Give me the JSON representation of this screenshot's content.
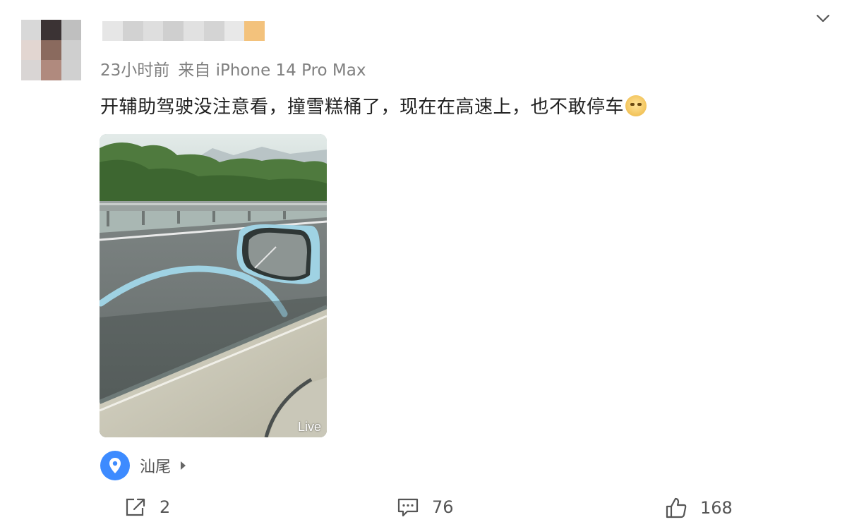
{
  "post": {
    "meta": {
      "time": "23小时前",
      "source": "来自 iPhone 14 Pro Max"
    },
    "text": "开辅助驾驶没注意看，撞雪糕桶了，现在在高速上，也不敢停车",
    "emoji_icon": "laughing-emoji-icon",
    "media": {
      "badge": "Live"
    },
    "location": {
      "label": "汕尾"
    }
  },
  "actions": {
    "repost_count": "2",
    "comment_count": "76",
    "like_count": "168"
  },
  "icons": {
    "collapse": "chevron-down-icon",
    "location": "location-pin-icon",
    "repost": "share-icon",
    "comment": "comment-icon",
    "like": "thumbs-up-icon"
  },
  "colors": {
    "accent": "#3d8bff",
    "meta_text": "#808080",
    "body_text": "#222222"
  }
}
